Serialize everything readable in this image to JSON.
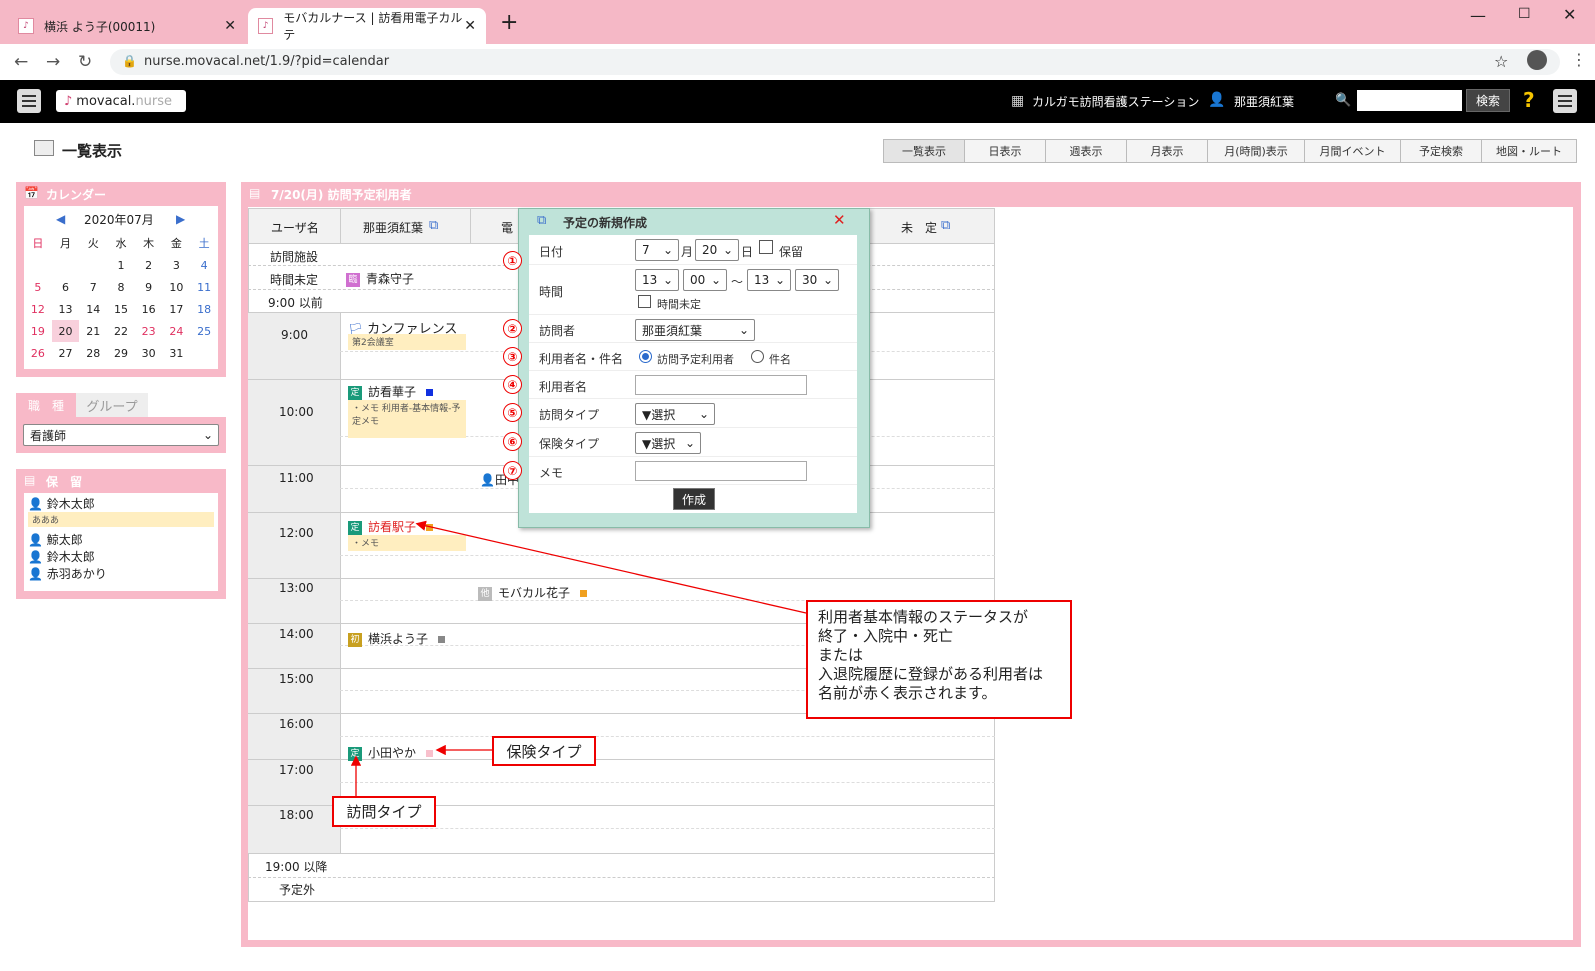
{
  "browser": {
    "tabs": [
      {
        "title": "横浜 よう子(00011)"
      },
      {
        "title": "モバカルナース | 訪看用電子カルテ"
      }
    ],
    "new_tab": "+",
    "url": "nurse.movacal.net/1.9/?pid=calendar"
  },
  "header": {
    "logo_main": "movacal.",
    "logo_sub": "nurse",
    "station": "カルガモ訪問看護ステーション",
    "user": "那亜須紅葉",
    "search_button": "検索",
    "help": "?"
  },
  "page": {
    "title": "一覧表示",
    "view_tabs": [
      "一覧表示",
      "日表示",
      "週表示",
      "月表示",
      "月(時間)表示",
      "月間イベント",
      "予定検索",
      "地図・ルート"
    ]
  },
  "calendar": {
    "header": "カレンダー",
    "month": "2020年07月",
    "weekdays": [
      "日",
      "月",
      "火",
      "水",
      "木",
      "金",
      "土"
    ],
    "weeks": [
      [
        "",
        "",
        "",
        "1",
        "2",
        "3",
        "4"
      ],
      [
        "5",
        "6",
        "7",
        "8",
        "9",
        "10",
        "11"
      ],
      [
        "12",
        "13",
        "14",
        "15",
        "16",
        "17",
        "18"
      ],
      [
        "19",
        "20",
        "21",
        "22",
        "23",
        "24",
        "25"
      ],
      [
        "26",
        "27",
        "28",
        "29",
        "30",
        "31",
        ""
      ]
    ],
    "selected": "20"
  },
  "filter": {
    "tab_active": "職　種",
    "tab_inactive": "グループ",
    "value": "看護師"
  },
  "hold": {
    "header": "保　留",
    "items": [
      {
        "name": "鈴木太郎",
        "memo": "あああ"
      },
      {
        "name": "鯨太郎"
      },
      {
        "name": "鈴木太郎"
      },
      {
        "name": "赤羽あかり"
      }
    ]
  },
  "schedule": {
    "header": "7/20(月) 訪問予定利用者",
    "col_user": "ユーザ名",
    "col_staff": "那亜須紅葉",
    "col_next": "電",
    "col_unassigned": "未　定",
    "rows": {
      "facility": "訪問施設",
      "untimed": "時間未定",
      "before9": "9:00 以前",
      "after19": "19:00 以降",
      "unscheduled": "予定外"
    },
    "hours": [
      "9:00",
      "10:00",
      "11:00",
      "12:00",
      "13:00",
      "14:00",
      "15:00",
      "16:00",
      "17:00",
      "18:00"
    ],
    "events": {
      "untimed": {
        "badge": "臨",
        "name": "青森守子"
      },
      "conference": {
        "name": "カンファレンス",
        "memo": "第2会議室"
      },
      "e1000": {
        "badge": "定",
        "name": "訪看華子",
        "memo": "・メモ 利用者-基本情報-予定メモ"
      },
      "e1100": {
        "name": "田中"
      },
      "e1200": {
        "badge": "定",
        "name": "訪看駅子",
        "memo": "・メモ"
      },
      "e1300": {
        "badge": "他",
        "name": "モバカル花子"
      },
      "e1400": {
        "badge": "初",
        "name": "横浜よう子"
      },
      "e1600": {
        "badge": "定",
        "name": "小田やか"
      }
    }
  },
  "modal": {
    "title": "予定の新規作成",
    "date_label": "日付",
    "month": "7",
    "month_unit": "月",
    "day": "20",
    "day_unit": "日",
    "hold_label": "保留",
    "time_label": "時間",
    "start_h": "13",
    "start_m": "00",
    "tilde": "～",
    "end_h": "13",
    "end_m": "30",
    "time_undecided": "時間未定",
    "visitor_label": "訪問者",
    "visitor": "那亜須紅葉",
    "name_subject_label": "利用者名・件名",
    "radio1": "訪問予定利用者",
    "radio2": "件名",
    "user_name_label": "利用者名",
    "visit_type_label": "訪問タイプ",
    "visit_type": "▼選択",
    "insurance_label": "保険タイプ",
    "insurance": "▼選択",
    "memo_label": "メモ",
    "create": "作成",
    "numbers": [
      "①",
      "②",
      "③",
      "④",
      "⑤",
      "⑥",
      "⑦"
    ]
  },
  "annotations": {
    "status_note": [
      "利用者基本情報のステータスが",
      "終了・入院中・死亡",
      "または",
      "入退院履歴に登録がある利用者は",
      "名前が赤く表示されます。"
    ],
    "insurance_type": "保険タイプ",
    "visit_type": "訪問タイプ"
  },
  "colors": {
    "pink": "#f8b9c8",
    "teal_badge": "#1a9a7a",
    "red_text": "#e02020",
    "modal_bg": "#bfe3d9"
  }
}
